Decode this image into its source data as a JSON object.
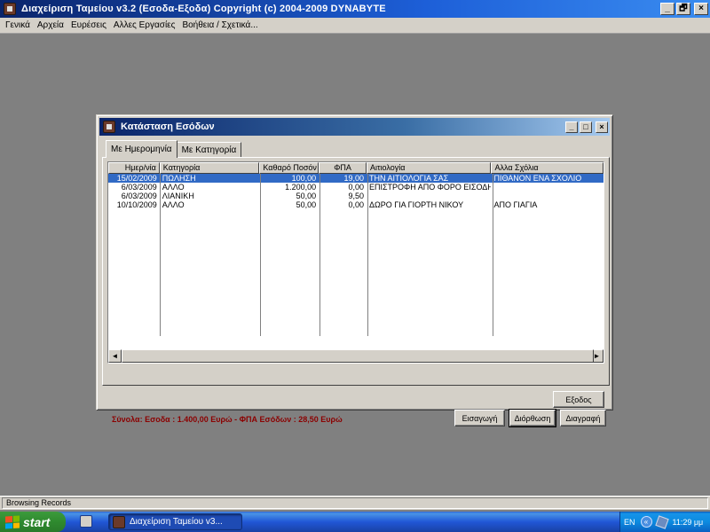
{
  "main_window": {
    "title": "Διαχείριση Ταμείου v3.2   (Εσοδα-Εξοδα)    Copyright (c) 2004-2009 DYNABYTE",
    "controls": {
      "minimize": "_",
      "maximize": "🗗",
      "close": "×"
    }
  },
  "menubar": {
    "items": [
      {
        "label": "Γενικά"
      },
      {
        "label": "Αρχεία"
      },
      {
        "label": "Ευρέσεις"
      },
      {
        "label": "Αλλες Εργασίες"
      },
      {
        "label": "Βοήθεια / Σχετικά..."
      }
    ]
  },
  "dialog": {
    "title": "Κατάσταση Εσόδων",
    "controls": {
      "minimize": "_",
      "maximize": "□",
      "close": "×"
    },
    "tabs": [
      {
        "label": "Με Ημερομηνία",
        "active": true
      },
      {
        "label": "Με Κατηγορία",
        "active": false
      }
    ],
    "columns": [
      "Ημερ/νία",
      "Κατηγορία",
      "Καθαρό Ποσόν",
      "ΦΠΑ",
      "Αιτιολογία",
      "Αλλα Σχόλια"
    ],
    "rows": [
      {
        "date": "15/02/2009",
        "category": "ΠΩΛΗΣΗ",
        "net": "100,00",
        "vat": "19,00",
        "reason": "ΤΗΝ ΑΙΤΙΟΛΟΓΙΑ ΣΑΣ",
        "comments": "ΠΙΘΑΝΟΝ ΕΝΑ ΣΧΟΛΙΟ",
        "selected": true
      },
      {
        "date": "6/03/2009",
        "category": "ΑΛΛΟ",
        "net": "1.200,00",
        "vat": "0,00",
        "reason": "ΕΠΙΣΤΡΟΦΗ ΑΠΟ ΦΟΡΟ ΕΙΣΟΔΗΜΑΤ",
        "comments": "",
        "selected": false
      },
      {
        "date": "6/03/2009",
        "category": "ΛΙΑΝΙΚΗ",
        "net": "50,00",
        "vat": "9,50",
        "reason": "",
        "comments": "",
        "selected": false
      },
      {
        "date": "10/10/2009",
        "category": "ΑΛΛΟ",
        "net": "50,00",
        "vat": "0,00",
        "reason": "ΔΩΡΟ ΓΙΑ ΓΙΟΡΤΗ ΝΙΚΟΥ",
        "comments": "ΑΠΟ ΓΙΑΓΙΑ",
        "selected": false
      }
    ],
    "scroll": {
      "left": "◄",
      "right": "►"
    },
    "totals": "Σύνολα:  Εσοδα : 1.400,00 Ευρώ  -  ΦΠΑ Εσόδων : 28,50 Ευρώ",
    "buttons": {
      "insert": "Εισαγωγή",
      "edit": "Διόρθωση",
      "delete": "Διαγραφή",
      "exit": "Εξοδος"
    }
  },
  "statusbar": {
    "text": "Browsing Records"
  },
  "taskbar": {
    "start_label": "start",
    "task_label": "Διαχείριση Ταμείου v3...",
    "tray": {
      "lang": "EN",
      "arrow": "«",
      "clock": "11:29 μμ"
    }
  }
}
